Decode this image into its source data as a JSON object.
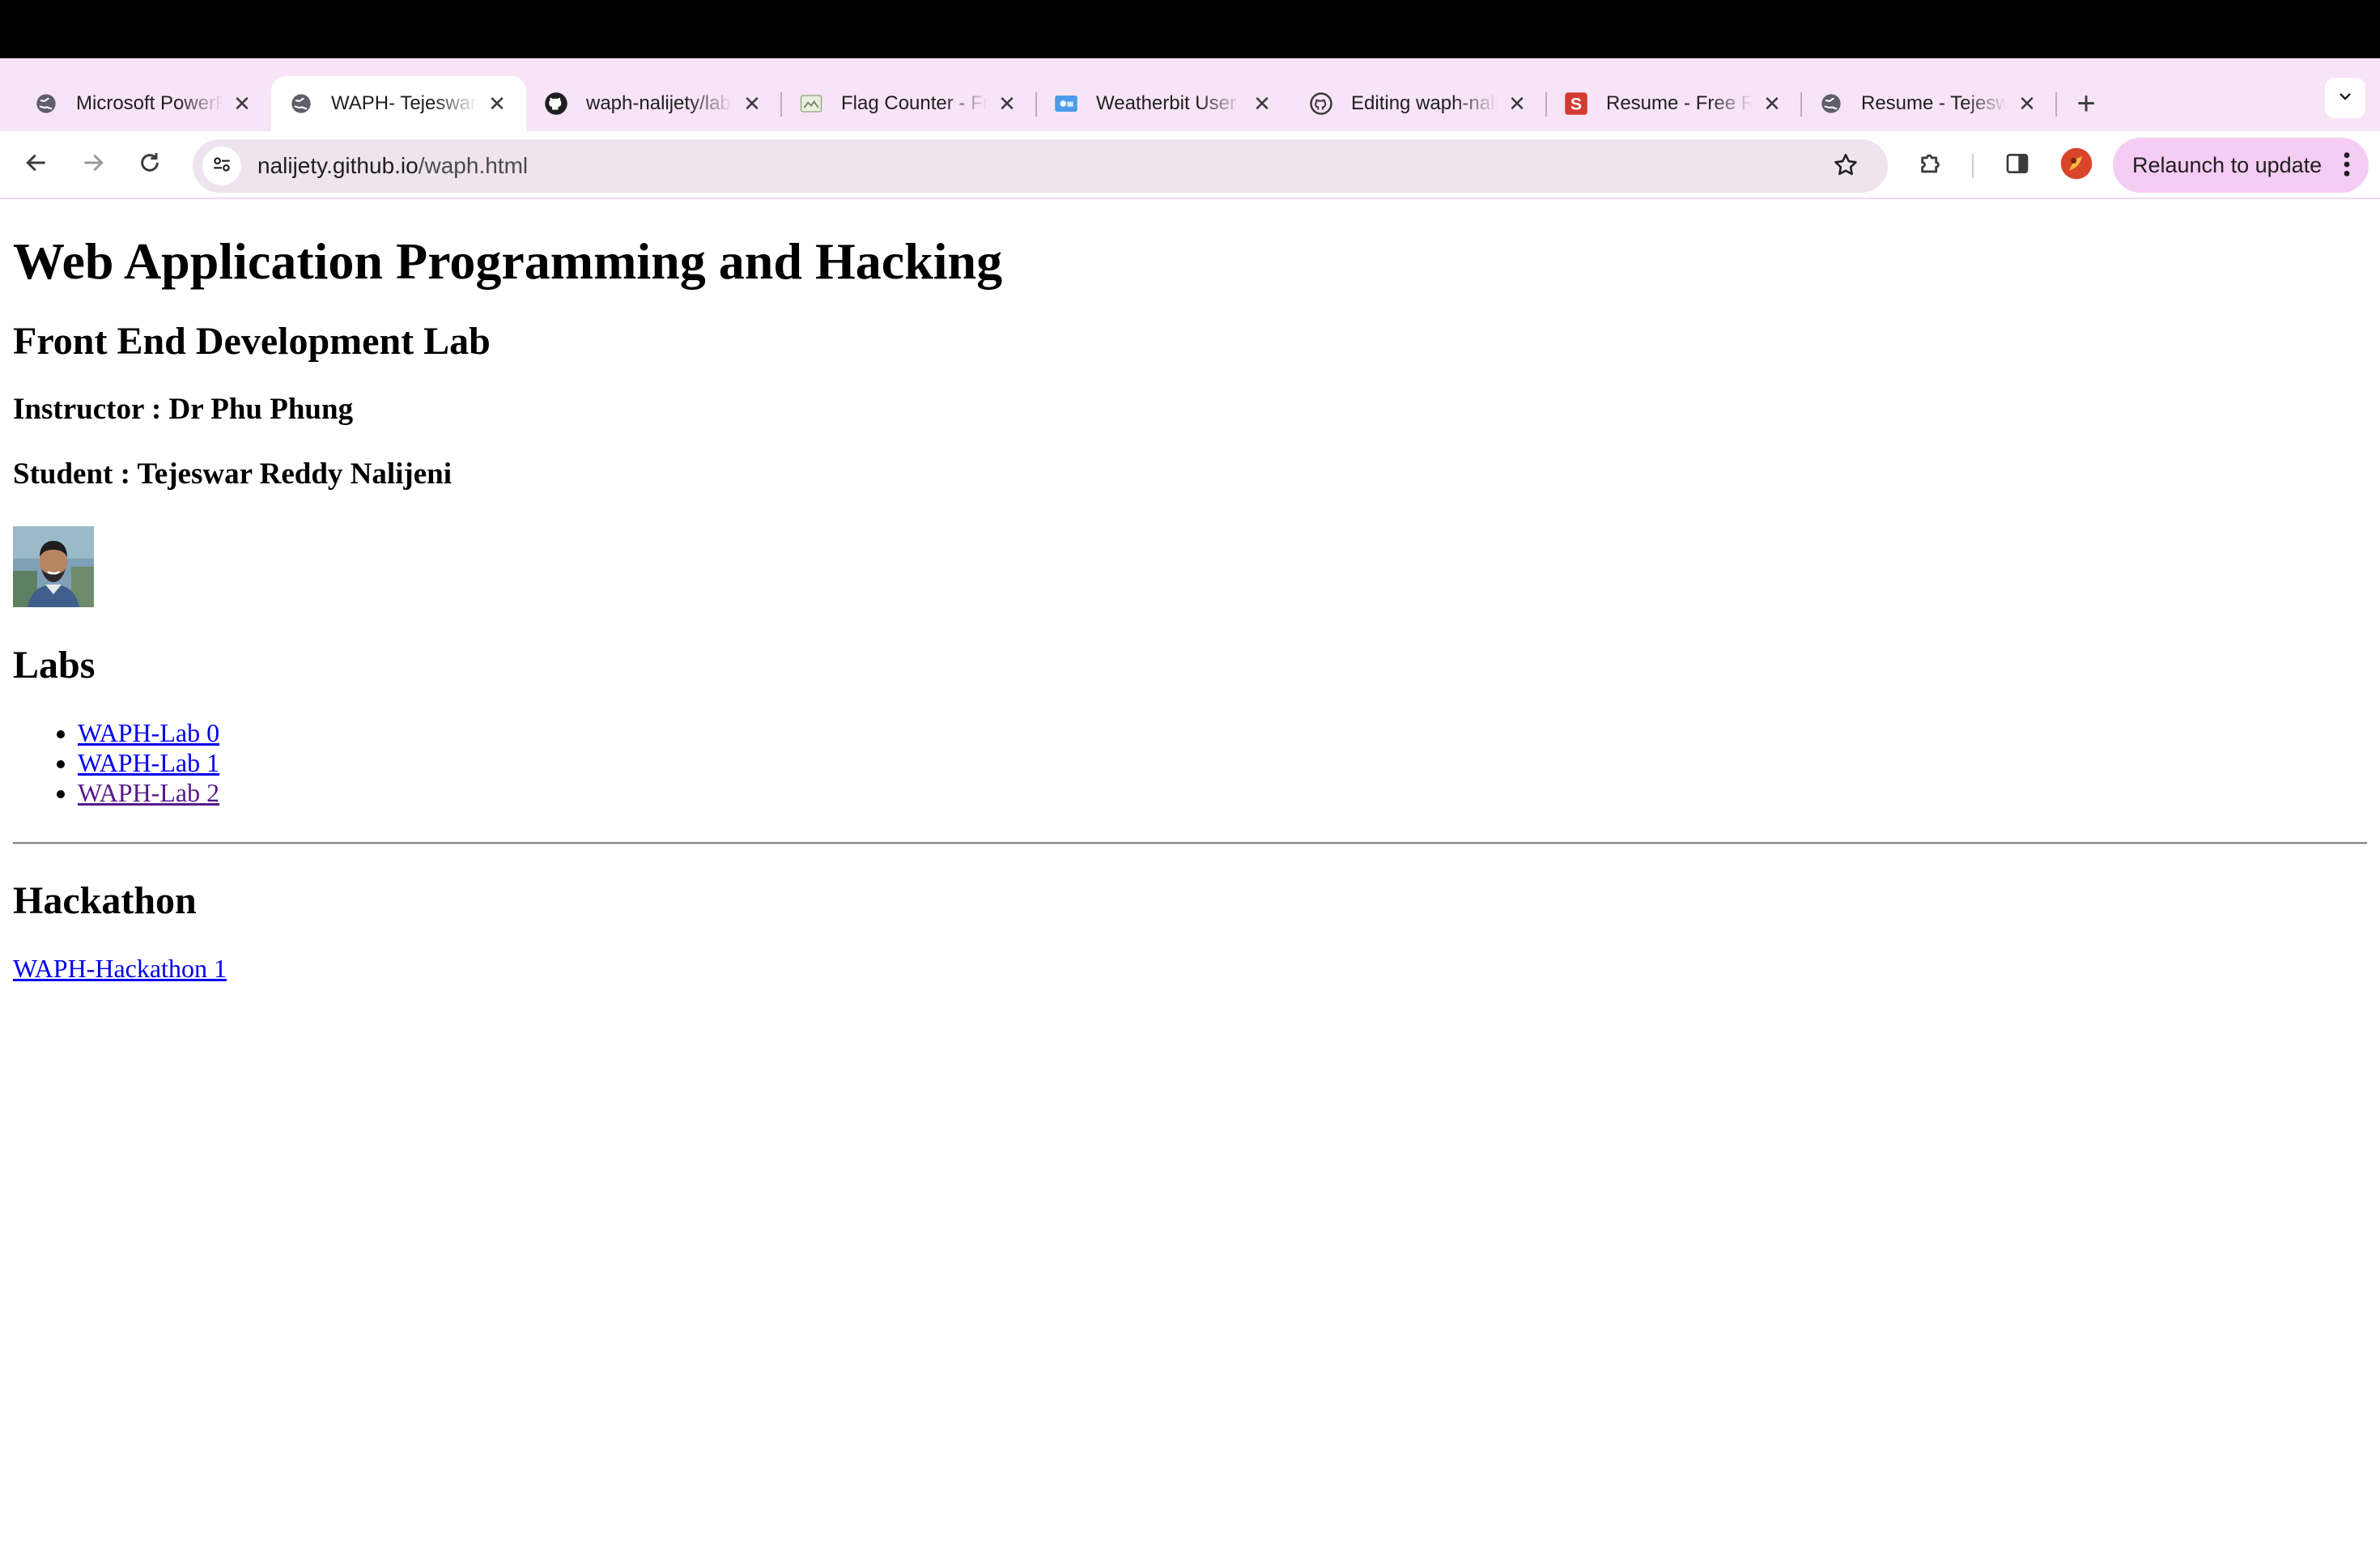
{
  "browser": {
    "tabs": [
      {
        "title": "Microsoft PowerPoint",
        "icon": "globe-icon",
        "active": false
      },
      {
        "title": "WAPH- Tejeswar Reddy",
        "icon": "globe-icon",
        "active": true
      },
      {
        "title": "waph-nalijety/labs",
        "icon": "github-icon",
        "active": false
      },
      {
        "title": "Flag Counter - Free",
        "icon": "flag-counter-icon",
        "active": false
      },
      {
        "title": "Weatherbit User",
        "icon": "weatherbit-icon",
        "active": false
      },
      {
        "title": "Editing waph-nalijety",
        "icon": "github-icon",
        "active": false
      },
      {
        "title": "Resume - Free Resume",
        "icon": "resume-s-icon",
        "active": false
      },
      {
        "title": "Resume - Tejeswar",
        "icon": "globe-icon",
        "active": false
      }
    ],
    "close_glyph": "✕",
    "new_tab_glyph": "+",
    "url_host": "nalijety.github.io",
    "url_path": "/waph.html",
    "relaunch_label": "Relaunch to update",
    "accent": "#f5ccf3"
  },
  "page": {
    "title": "Web Application Programming and Hacking",
    "subtitle": "Front End Development Lab",
    "instructor": "Instructor : Dr Phu Phung",
    "student": "Student : Tejeswar Reddy Nalijeni",
    "labs_heading": "Labs",
    "labs": [
      {
        "label": "WAPH-Lab 0",
        "visited": false
      },
      {
        "label": "WAPH-Lab 1",
        "visited": false
      },
      {
        "label": "WAPH-Lab 2",
        "visited": true
      }
    ],
    "hackathon_heading": "Hackathon",
    "hackathons": [
      {
        "label": "WAPH-Hackathon 1"
      }
    ]
  }
}
